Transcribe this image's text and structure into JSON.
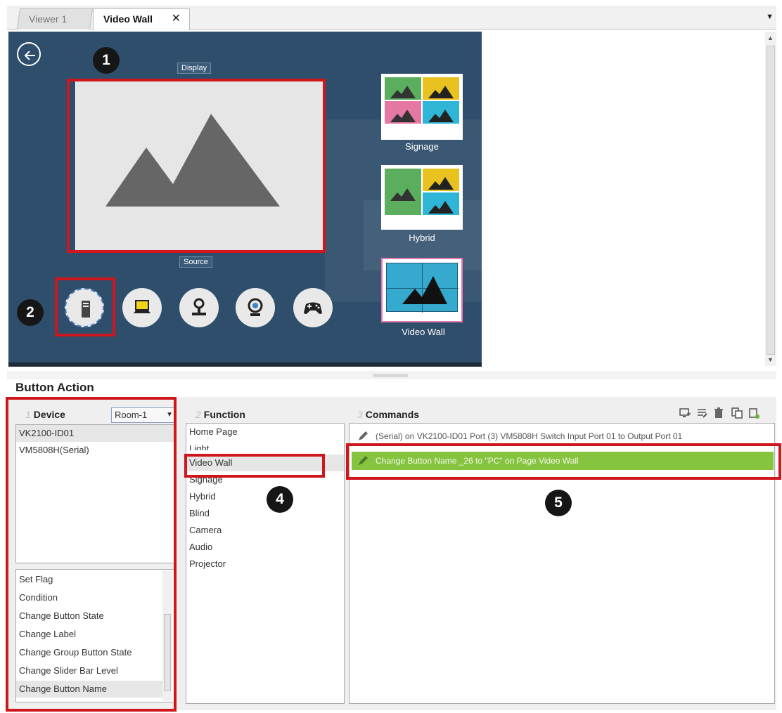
{
  "tabs": [
    {
      "label": "Viewer 1",
      "active": false
    },
    {
      "label": "Video Wall",
      "active": true,
      "close_glyph": "✕"
    }
  ],
  "tab_menu_icon": "dropdown-arrow-icon",
  "canvas": {
    "background": "#2e4e6c",
    "display_label": "Display",
    "source_label": "Source",
    "back_icon": "back-arrow-icon",
    "source_buttons": [
      {
        "icon": "pc-tower-icon"
      },
      {
        "icon": "laptop-icon"
      },
      {
        "icon": "document-camera-icon"
      },
      {
        "icon": "webcam-icon"
      },
      {
        "icon": "gamepad-icon"
      }
    ],
    "pages": [
      {
        "label": "Signage"
      },
      {
        "label": "Hybrid"
      },
      {
        "label": "Video Wall"
      }
    ]
  },
  "markers": [
    "1",
    "2",
    "4",
    "5"
  ],
  "highlight_color": "#d0161d",
  "button_action": {
    "title": "Button Action",
    "device": {
      "number": "1",
      "header": "Device",
      "room": "Room-1",
      "devices": [
        "VK2100-ID01",
        "VM5808H(Serial)"
      ],
      "actions": [
        "Set Flag",
        "Condition",
        "Change Button State",
        "Change Label",
        "Change Group Button State",
        "Change Slider Bar Level",
        "Change Button Name"
      ]
    },
    "function": {
      "number": "2",
      "header": "Function",
      "items": [
        "Home Page",
        "Light",
        "Video Wall",
        "Signage",
        "Hybrid",
        "Blind",
        "Camera",
        "Audio",
        "Projector"
      ]
    },
    "commands": {
      "number": "3",
      "header": "Commands",
      "items": [
        "(Serial) on VK2100-ID01 Port (3) VM5808H Switch Input Port 01 to Output Port 01",
        "Change Button Name _26 to \"PC\" on Page Video Wall"
      ],
      "selected_color": "#86c440",
      "toolbar": [
        "add-command-icon",
        "edit-command-icon",
        "delete-icon",
        "copy-icon",
        "paste-icon"
      ]
    }
  }
}
